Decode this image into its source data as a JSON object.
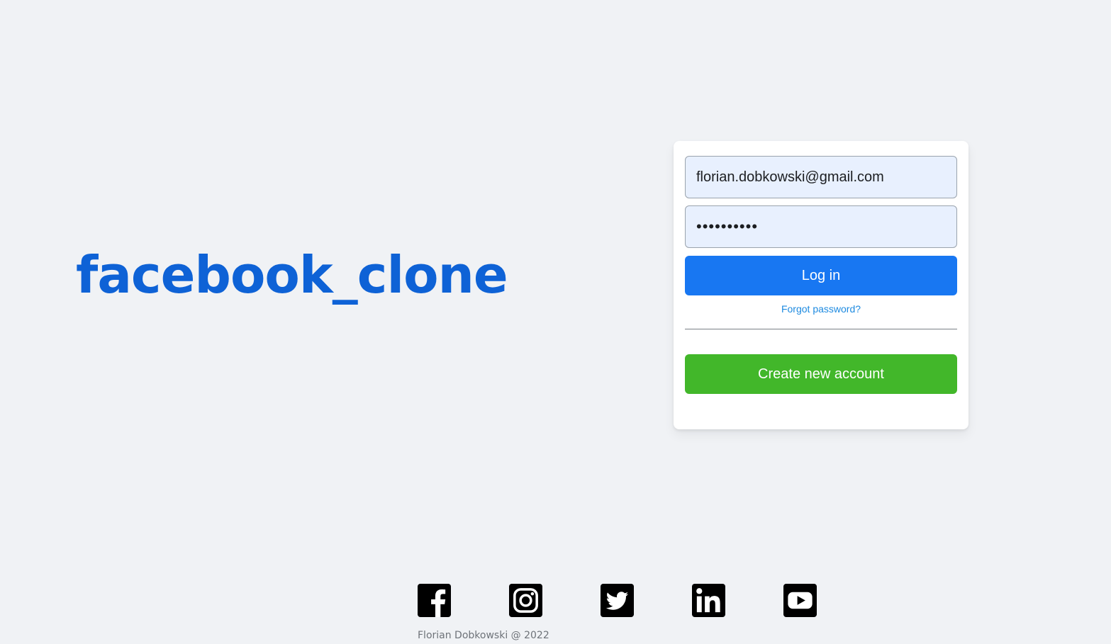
{
  "logo": {
    "text": "facebook_clone"
  },
  "login_form": {
    "email_value": "florian.dobkowski@gmail.com",
    "password_value": "••••••••••",
    "login_label": "Log in",
    "forgot_label": "Forgot password?",
    "create_label": "Create new account"
  },
  "social_links": [
    {
      "icon": "facebook-icon"
    },
    {
      "icon": "instagram-icon"
    },
    {
      "icon": "twitter-icon"
    },
    {
      "icon": "linkedin-icon"
    },
    {
      "icon": "youtube-icon"
    }
  ],
  "footer": {
    "text": "Florian Dobkowski @ 2022"
  },
  "colors": {
    "background": "#f0f2f5",
    "logo": "#0e62d6",
    "login_button": "#1877f2",
    "create_button": "#42b72a",
    "link": "#1d8ae0"
  }
}
